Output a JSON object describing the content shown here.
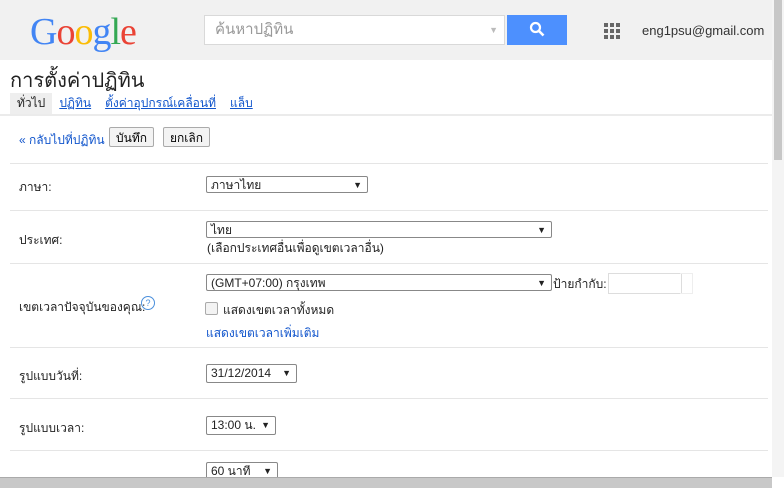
{
  "header": {
    "logo": "Google",
    "search_placeholder": "ค้นหาปฏิทิน",
    "email": "eng1psu@gmail.com"
  },
  "page_title": "การตั้งค่าปฏิทิน",
  "tabs": [
    {
      "label": "ทั่วไป"
    },
    {
      "label": "ปฏิทิน"
    },
    {
      "label": "ตั้งค่าอุปกรณ์เคลื่อนที่"
    },
    {
      "label": "แล็บ"
    }
  ],
  "actions": {
    "back": "« กลับไปที่ปฏิทิน",
    "save": "บันทึก",
    "cancel": "ยกเลิก"
  },
  "settings": {
    "language": {
      "label": "ภาษา:",
      "value": "ภาษาไทย"
    },
    "country": {
      "label": "ประเทศ:",
      "value": "ไทย",
      "note": "(เลือกประเทศอื่นเพื่อดูเขตเวลาอื่น)"
    },
    "timezone": {
      "label": "เขตเวลาปัจจุบันของคุณ:",
      "value": "(GMT+07:00) กรุงเทพ",
      "tag_label": "ป้ายกำกับ:",
      "tag_value": "",
      "show_all": "แสดงเขตเวลาทั้งหมด",
      "more_link": "แสดงเขตเวลาเพิ่มเติม"
    },
    "date_format": {
      "label": "รูปแบบวันที่:",
      "value": "31/12/2014"
    },
    "time_format": {
      "label": "รูปแบบเวลา:",
      "value": "13:00 น."
    },
    "duration": {
      "value": "60 นาที"
    }
  }
}
